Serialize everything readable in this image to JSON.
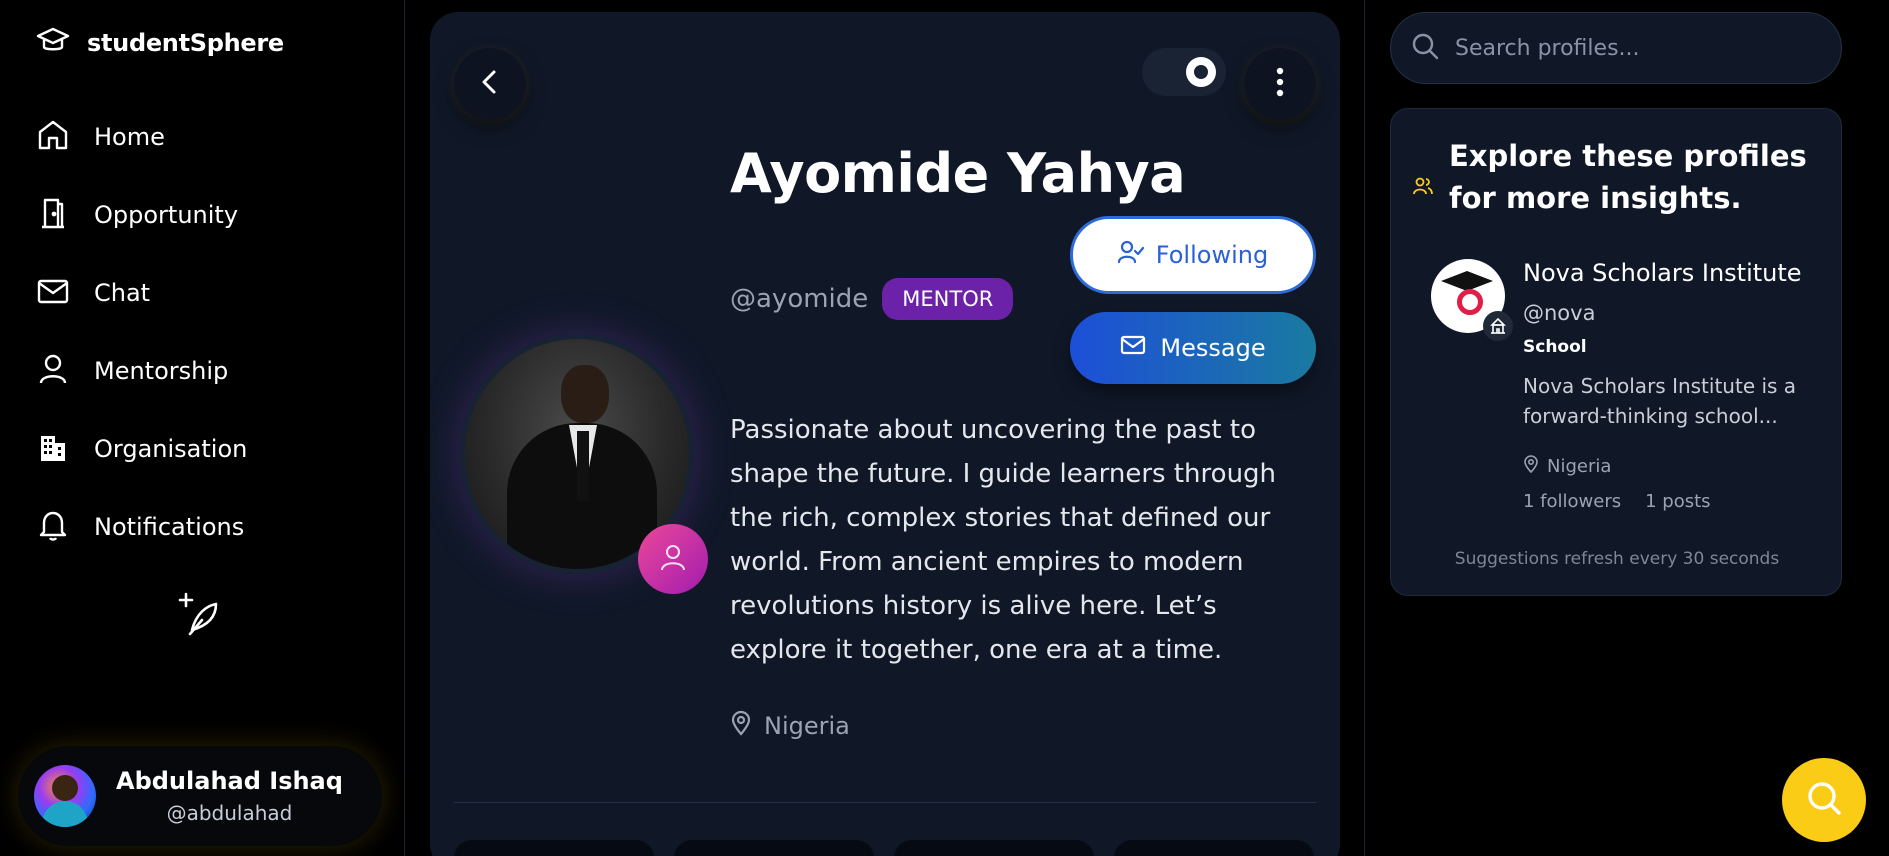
{
  "app": {
    "brand": "studentSphere"
  },
  "sidebar": {
    "items": [
      {
        "label": "Home",
        "icon": "home-icon"
      },
      {
        "label": "Opportunity",
        "icon": "door-icon"
      },
      {
        "label": "Chat",
        "icon": "mail-icon"
      },
      {
        "label": "Mentorship",
        "icon": "user-icon"
      },
      {
        "label": "Organisation",
        "icon": "building-icon"
      },
      {
        "label": "Notifications",
        "icon": "bell-icon"
      }
    ],
    "compose_icon": "feather-plus-icon",
    "user": {
      "name": "Abdulahad Ishaq",
      "handle": "@abdulahad"
    }
  },
  "profile": {
    "name": "Ayomide Yahya",
    "handle": "@ayomide",
    "role": "MENTOR",
    "follow_label": "Following",
    "message_label": "Message",
    "bio": "Passionate about uncovering the past to shape the future. I guide learners through the rich, complex stories that defined our world. From ancient empires to modern revolutions history is alive here. Let’s explore it together, one era at a time.",
    "location": "Nigeria"
  },
  "search": {
    "placeholder": "Search profiles..."
  },
  "suggestions": {
    "title": "Explore these profiles for more insights.",
    "items": [
      {
        "name": "Nova Scholars Institute",
        "handle": "@nova",
        "type": "School",
        "description": "Nova Scholars Institute is a forward-thinking school...",
        "location": "Nigeria",
        "followers": "1 followers",
        "posts": "1 posts"
      }
    ],
    "footer": "Suggestions refresh every 30 seconds"
  },
  "colors": {
    "accent": "#facc15",
    "badge": "#6b21a8",
    "panel": "#101828",
    "primary": "#1d4fd8"
  }
}
